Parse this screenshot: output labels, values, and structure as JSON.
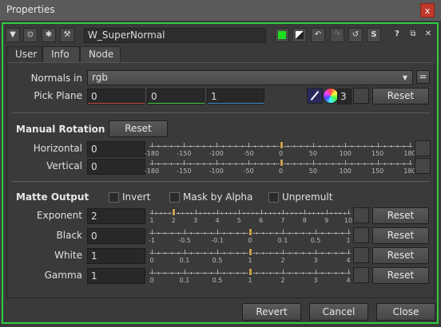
{
  "window": {
    "title": "Properties",
    "close": "x"
  },
  "header": {
    "node_name": "W_SuperNormal",
    "help": "?",
    "s_btn": "S"
  },
  "tabs": [
    "User",
    "Info",
    "Node"
  ],
  "normals_in": {
    "label": "Normals in",
    "value": "rgb",
    "eq": "="
  },
  "pick_plane": {
    "label": "Pick Plane",
    "x": "0",
    "y": "0",
    "z": "1",
    "count": "3",
    "reset": "Reset"
  },
  "manual_rotation": {
    "title": "Manual Rotation",
    "reset": "Reset",
    "horizontal": {
      "label": "Horizontal",
      "value": "0"
    },
    "vertical": {
      "label": "Vertical",
      "value": "0"
    },
    "ticks": [
      "-180",
      "-150",
      "-100",
      "-50",
      "0",
      "50",
      "100",
      "150",
      "180"
    ]
  },
  "matte_output": {
    "title": "Matte Output",
    "invert": "Invert",
    "mask_by_alpha": "Mask by Alpha",
    "unpremult": "Unpremult",
    "exponent": {
      "label": "Exponent",
      "value": "2",
      "reset": "Reset",
      "ticks": [
        "1",
        "2",
        "3",
        "4",
        "5",
        "6",
        "7",
        "8",
        "9",
        "10"
      ]
    },
    "black": {
      "label": "Black",
      "value": "0",
      "reset": "Reset",
      "ticks": [
        "-1",
        "-0.5",
        "-0.1",
        "0",
        "0.1",
        "0.5",
        "1"
      ]
    },
    "white": {
      "label": "White",
      "value": "1",
      "reset": "Reset",
      "ticks": [
        "0",
        "0.1",
        "0.5",
        "1",
        "2",
        "3",
        "4"
      ]
    },
    "gamma": {
      "label": "Gamma",
      "value": "1",
      "reset": "Reset",
      "ticks": [
        "0",
        "0.1",
        "0.5",
        "1",
        "2",
        "3",
        "4"
      ]
    }
  },
  "footer": {
    "revert": "Revert",
    "cancel": "Cancel",
    "close": "Close"
  }
}
